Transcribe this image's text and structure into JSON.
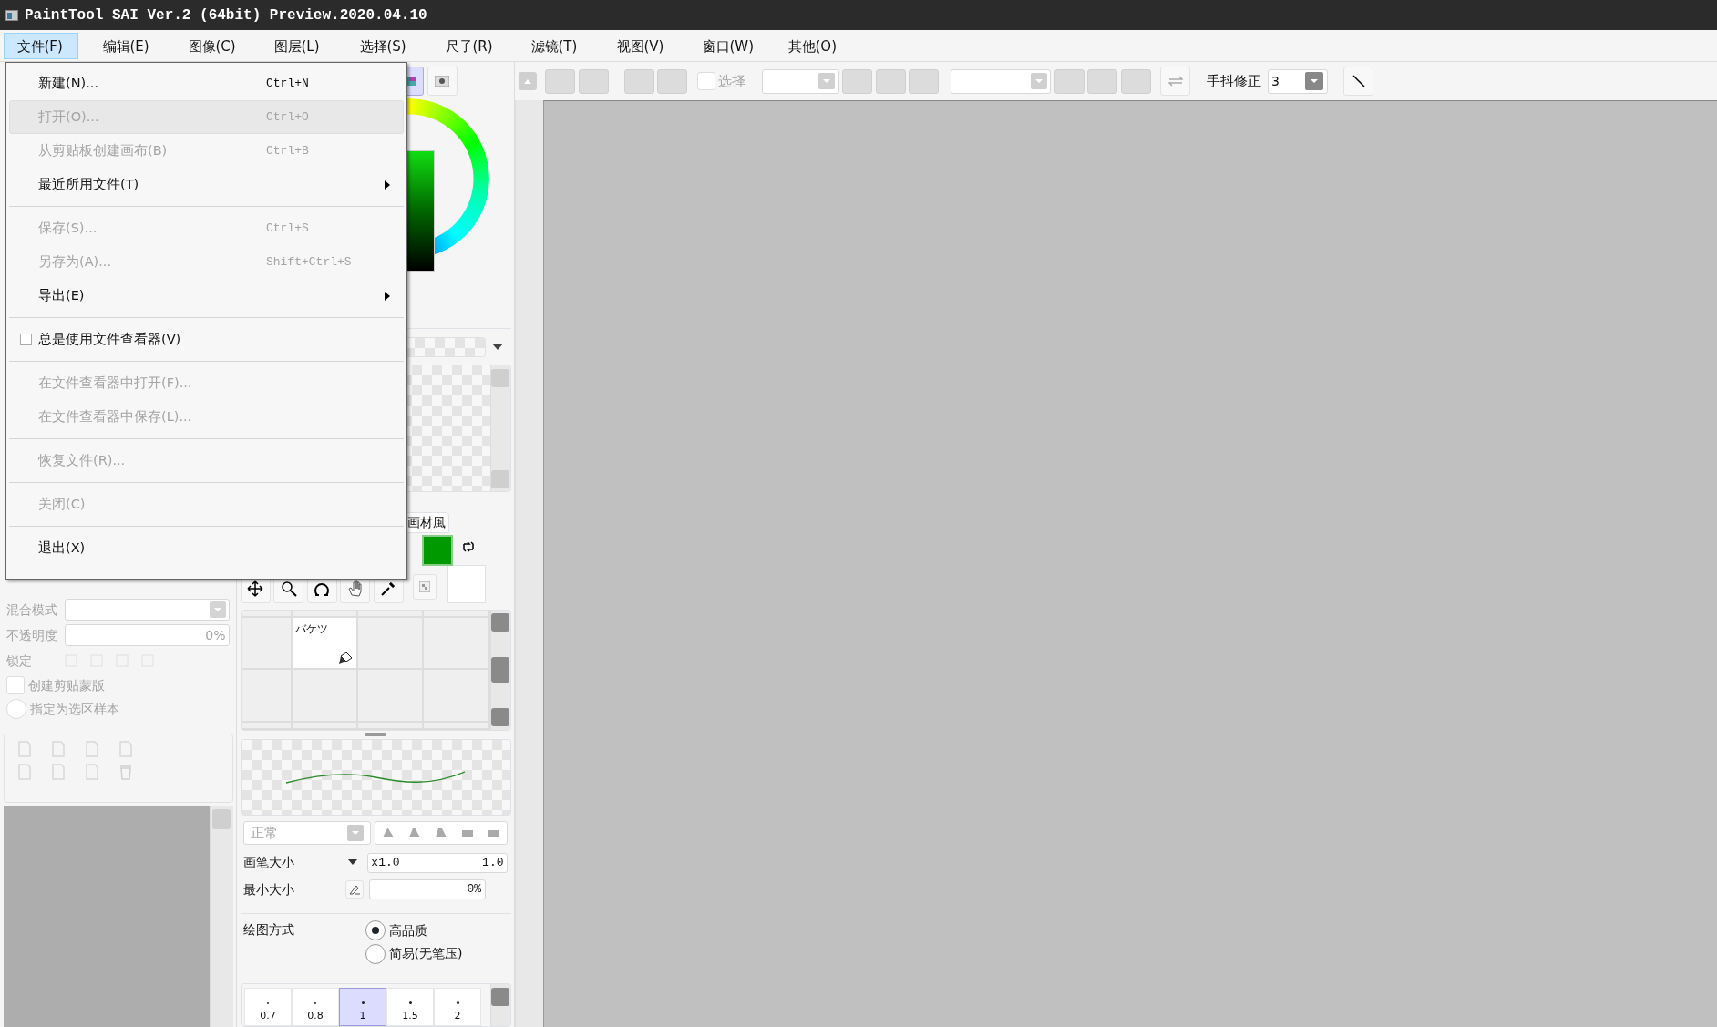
{
  "window": {
    "title": "PaintTool SAI Ver.2 (64bit) Preview.2020.04.10"
  },
  "menu_bar": [
    {
      "label": "文件(F)",
      "selected": true
    },
    {
      "label": "编辑(E)",
      "selected": false
    },
    {
      "label": "图像(C)",
      "selected": false
    },
    {
      "label": "图层(L)",
      "selected": false
    },
    {
      "label": "选择(S)",
      "selected": false
    },
    {
      "label": "尺子(R)",
      "selected": false
    },
    {
      "label": "滤镜(T)",
      "selected": false
    },
    {
      "label": "视图(V)",
      "selected": false
    },
    {
      "label": "窗口(W)",
      "selected": false
    },
    {
      "label": "其他(O)",
      "selected": false
    }
  ],
  "file_menu": [
    {
      "kind": "item",
      "label": "新建(N)...",
      "shortcut": "Ctrl+N",
      "disabled": false,
      "highlighted": false
    },
    {
      "kind": "item",
      "label": "打开(O)...",
      "shortcut": "Ctrl+O",
      "disabled": true,
      "highlighted": true
    },
    {
      "kind": "item",
      "label": "从剪贴板创建画布(B)",
      "shortcut": "Ctrl+B",
      "disabled": true,
      "highlighted": false
    },
    {
      "kind": "submenu",
      "label": "最近所用文件(T)",
      "disabled": false,
      "highlighted": false
    },
    {
      "kind": "separator"
    },
    {
      "kind": "item",
      "label": "保存(S)...",
      "shortcut": "Ctrl+S",
      "disabled": true,
      "highlighted": false
    },
    {
      "kind": "item",
      "label": "另存为(A)...",
      "shortcut": "Shift+Ctrl+S",
      "disabled": true,
      "highlighted": false
    },
    {
      "kind": "submenu",
      "label": "导出(E)",
      "disabled": false,
      "highlighted": false
    },
    {
      "kind": "separator"
    },
    {
      "kind": "checkbox",
      "label": "总是使用文件查看器(V)",
      "checked": false,
      "disabled": false,
      "highlighted": false
    },
    {
      "kind": "separator"
    },
    {
      "kind": "item",
      "label": "在文件查看器中打开(F)...",
      "disabled": true,
      "highlighted": false
    },
    {
      "kind": "item",
      "label": "在文件查看器中保存(L)...",
      "disabled": true,
      "highlighted": false
    },
    {
      "kind": "separator"
    },
    {
      "kind": "item",
      "label": "恢复文件(R)...",
      "disabled": true,
      "highlighted": false
    },
    {
      "kind": "separator"
    },
    {
      "kind": "item",
      "label": "关闭(C)",
      "disabled": true,
      "highlighted": false
    },
    {
      "kind": "separator"
    },
    {
      "kind": "item",
      "label": "退出(X)",
      "disabled": false,
      "highlighted": false
    }
  ],
  "toolbar": {
    "selection_checkbox": {
      "label": "选择",
      "checked": false,
      "disabled": true
    },
    "stabilizer": {
      "label": "手抖修正",
      "value": "3"
    }
  },
  "layer_properties": {
    "disabled": true,
    "blend_mode_label": "混合模式",
    "opacity_label": "不透明度",
    "opacity_value": "0%",
    "lock_label": "锁定",
    "options": [
      {
        "kind": "checkbox",
        "label": "创建剪贴蒙版",
        "checked": false
      },
      {
        "kind": "radio",
        "label": "指定为选区样本",
        "checked": false
      }
    ]
  },
  "material_tab": {
    "label": "画材風"
  },
  "tool_palette": {
    "cells": [
      {
        "label": "バケツ",
        "selected": true
      }
    ]
  },
  "brush": {
    "blend_mode": "正常",
    "size_label": "画笔大小",
    "size_multiplier": "x1.0",
    "size_value": "1.0",
    "min_size_label": "最小大小",
    "min_size_value": "0%",
    "draw_mode_label": "绘图方式",
    "draw_modes": [
      {
        "label": "高品质",
        "selected": true
      },
      {
        "label": "简易(无笔压)",
        "selected": false
      }
    ],
    "sizes": [
      {
        "label": "0.7",
        "selected": false
      },
      {
        "label": "0.8",
        "selected": false
      },
      {
        "label": "1",
        "selected": true
      },
      {
        "label": "1.5",
        "selected": false
      },
      {
        "label": "2",
        "selected": false
      }
    ]
  }
}
